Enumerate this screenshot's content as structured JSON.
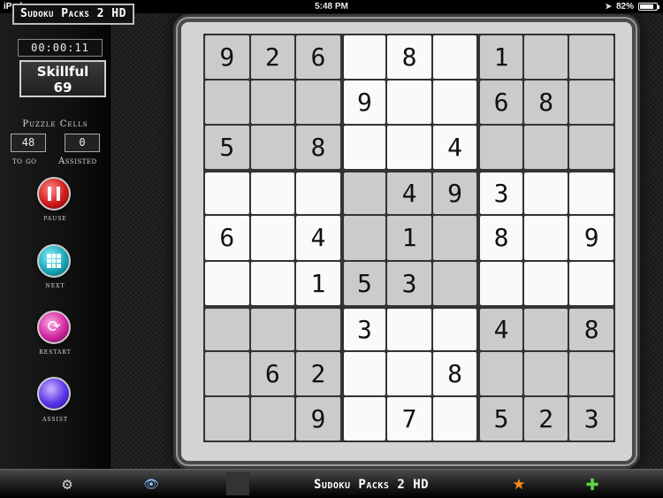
{
  "status_bar": {
    "device": "iPad",
    "time": "5:48 PM",
    "battery_percent": "82%",
    "battery_level": 0.82
  },
  "side_panel": {
    "app_title": "Sudoku Packs 2 HD",
    "timer": "00:00:11",
    "level_name": "Skillful",
    "level_number": "69",
    "cells_heading": "Puzzle Cells",
    "to_go_value": "48",
    "to_go_label": "to go",
    "assisted_value": "0",
    "assisted_label": "Assisted",
    "buttons": [
      {
        "label": "pause",
        "icon": "pause-icon",
        "color": "#d01a1a"
      },
      {
        "label": "next",
        "icon": "grid-icon",
        "color": "#18a6b8"
      },
      {
        "label": "restart",
        "icon": "restart-icon",
        "color": "#d0289e"
      },
      {
        "label": "assist",
        "icon": "orb-icon",
        "color": "#5a34e8"
      }
    ]
  },
  "board": {
    "grid": [
      [
        "9",
        "2",
        "6",
        "",
        "8",
        "",
        "1",
        "",
        ""
      ],
      [
        "",
        "",
        "",
        "9",
        "",
        "",
        "6",
        "8",
        ""
      ],
      [
        "5",
        "",
        "8",
        "",
        "",
        "4",
        "",
        "",
        ""
      ],
      [
        "",
        "",
        "",
        "",
        "4",
        "9",
        "3",
        "",
        ""
      ],
      [
        "6",
        "",
        "4",
        "",
        "1",
        "",
        "8",
        "",
        "9"
      ],
      [
        "",
        "",
        "1",
        "5",
        "3",
        "",
        "",
        "",
        ""
      ],
      [
        "",
        "",
        "",
        "3",
        "",
        "",
        "4",
        "",
        "8"
      ],
      [
        "",
        "6",
        "2",
        "",
        "",
        "8",
        "",
        "",
        ""
      ],
      [
        "",
        "",
        "9",
        "",
        "7",
        "",
        "5",
        "2",
        "3"
      ]
    ],
    "shade_light": "#fafafa",
    "shade_dark": "#cbcbcb"
  },
  "toolbar": {
    "title": "Sudoku Packs 2 HD",
    "icons": [
      "gear-icon",
      "eye-icon",
      "puzzle-thumbnail-icon",
      "star-icon",
      "plus-icon"
    ],
    "star_color": "#ff8a1c",
    "plus_color": "#5bd445"
  }
}
